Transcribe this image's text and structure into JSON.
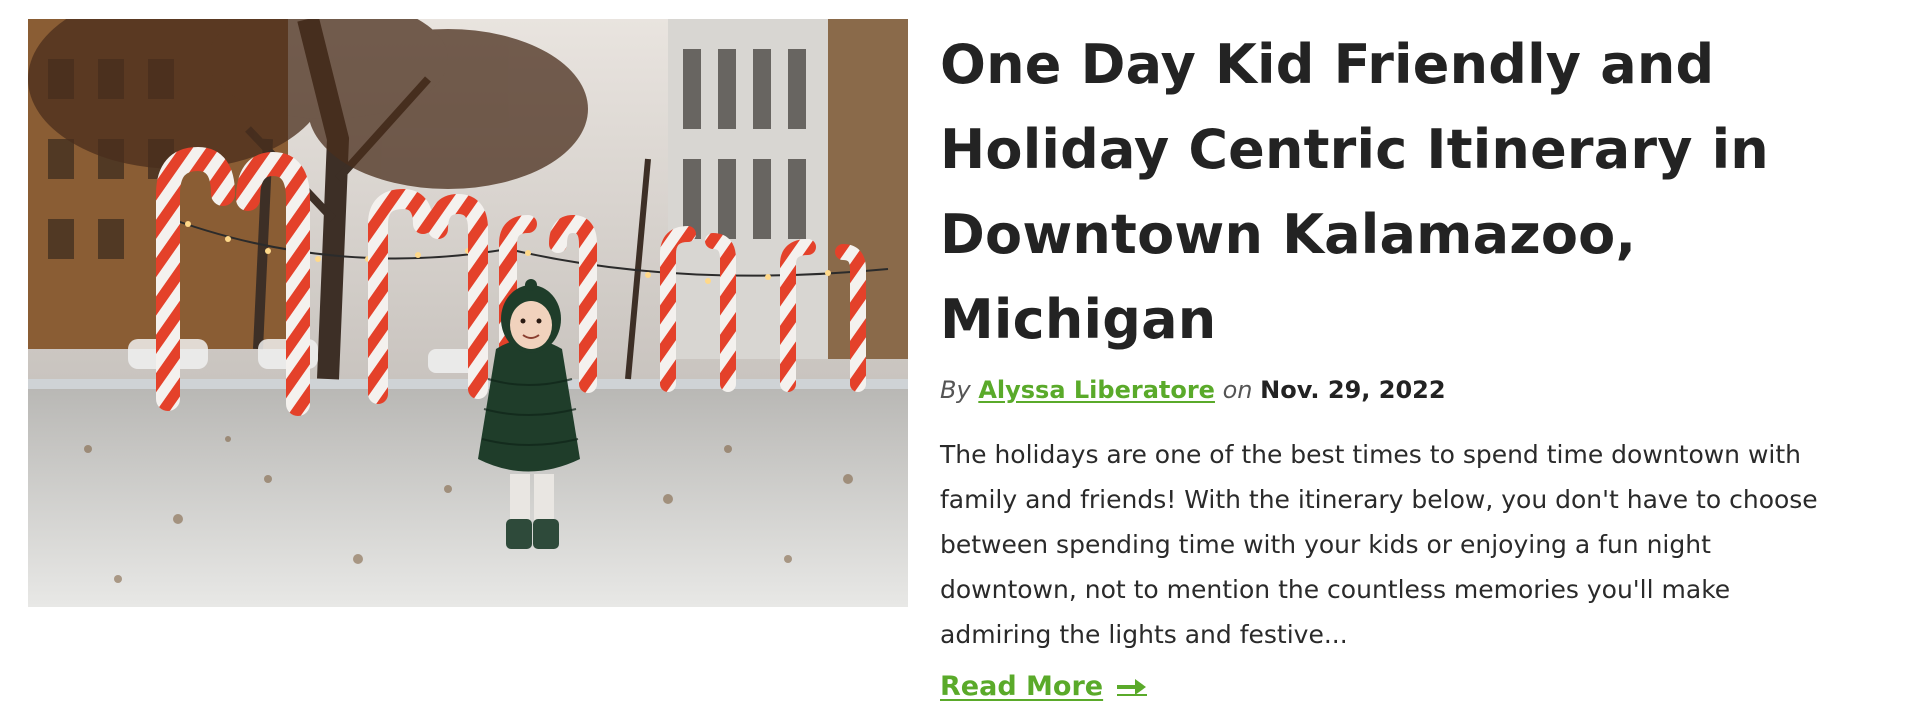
{
  "post": {
    "image_alt": "Child in a green puffer jacket standing in snow in front of giant candy cane arches downtown",
    "title": "One Day Kid Friendly and Holiday Centric Itinerary in Downtown Kalamazoo, Michigan",
    "meta": {
      "by_label": "By",
      "author": "Alyssa Liberatore",
      "on_label": "on",
      "date": "Nov. 29, 2022"
    },
    "excerpt": "The holidays are one of the best times to spend time downtown with family and friends! With the itinerary below, you don't have to choose between spending time with your kids or enjoying a fun night downtown, not to mention the countless memories you'll make admiring the lights and festive...",
    "read_more_label": "Read More",
    "read_more_icon": "arrow-right-icon"
  },
  "colors": {
    "link_green": "#5aaa2a",
    "title_text": "#232323",
    "body_text": "#2a2a2a"
  }
}
